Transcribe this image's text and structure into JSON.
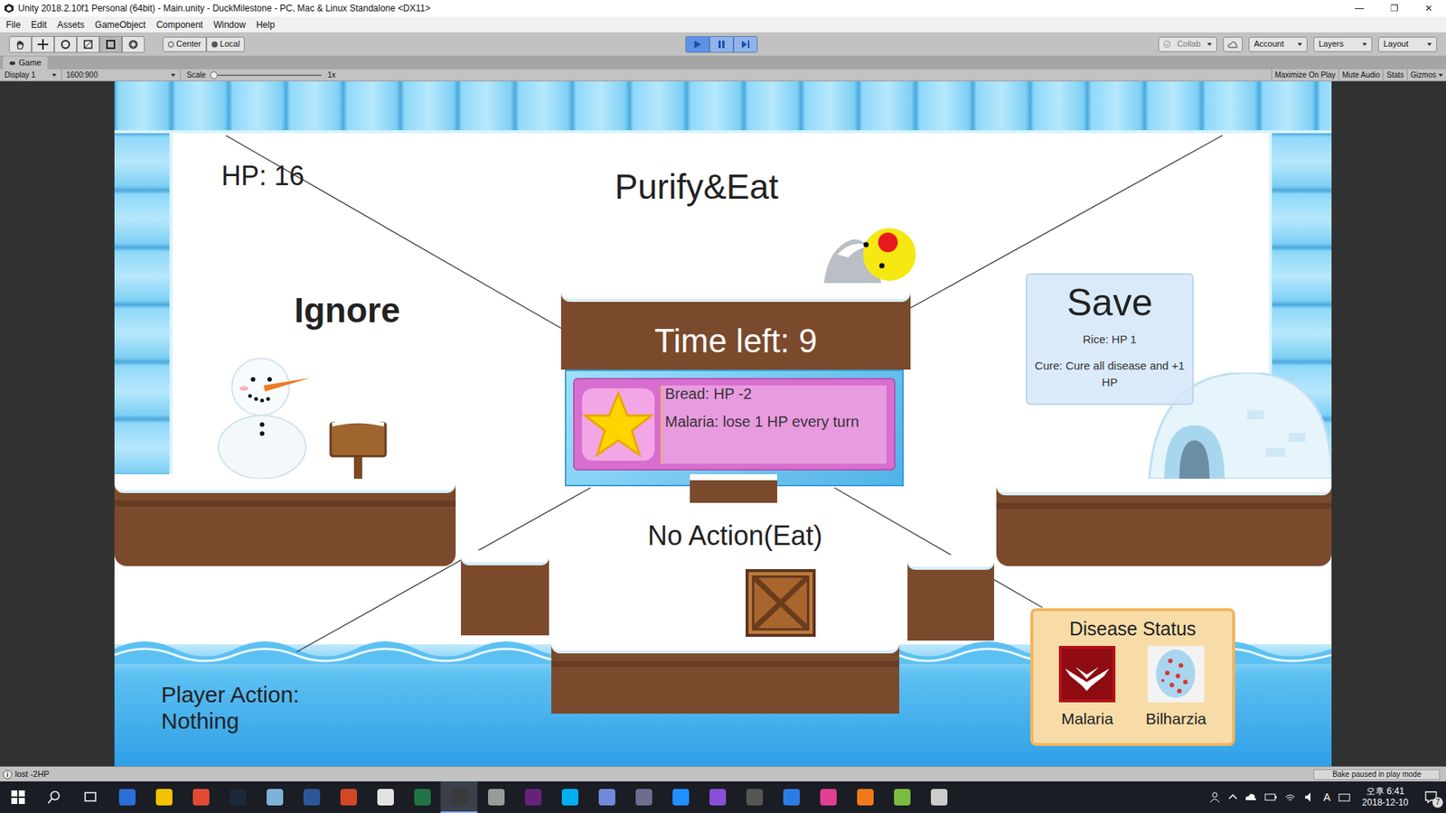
{
  "window": {
    "title": "Unity 2018.2.10f1 Personal (64bit) - Main.unity - DuckMilestone - PC, Mac & Linux Standalone <DX11>",
    "controls": [
      "—",
      "❐",
      "✕"
    ]
  },
  "menu": [
    "File",
    "Edit",
    "Assets",
    "GameObject",
    "Component",
    "Window",
    "Help"
  ],
  "toolbar": {
    "pivot": "Center",
    "space": "Local",
    "playing": true,
    "right": [
      "Collab",
      "Account",
      "Layers",
      "Layout"
    ]
  },
  "panel_tab": "Game",
  "game_toolbar": {
    "display": "Display 1",
    "resolution": "1600:900",
    "scale_label": "Scale",
    "scale_value": "1x",
    "scale_level": 0,
    "toggles": [
      "Maximize On Play",
      "Mute Audio",
      "Stats",
      "Gizmos"
    ]
  },
  "game": {
    "hp": "HP: 16",
    "title": "Purify&Eat",
    "ignore": "Ignore",
    "timer": "Time left: 9",
    "save": {
      "title": "Save",
      "lines": [
        "Rice: HP 1",
        "Cure: Cure all disease and +1 HP"
      ]
    },
    "card": {
      "lines": [
        "Bread: HP -2",
        "Malaria: lose 1 HP every turn"
      ]
    },
    "no_action": "No Action(Eat)",
    "player_action": [
      "Player Action:",
      "Nothing"
    ],
    "disease": {
      "title": "Disease Status",
      "items": [
        {
          "name": "Malaria",
          "kind": "malaria"
        },
        {
          "name": "Bilharzia",
          "kind": "bilharzia"
        }
      ]
    }
  },
  "status_bar": {
    "message": "lost -2HP",
    "right": "Bake paused in play mode"
  },
  "taskbar": {
    "ime": "A",
    "time": "오후 6:41",
    "date": "2018-12-10",
    "notifications": "7"
  }
}
